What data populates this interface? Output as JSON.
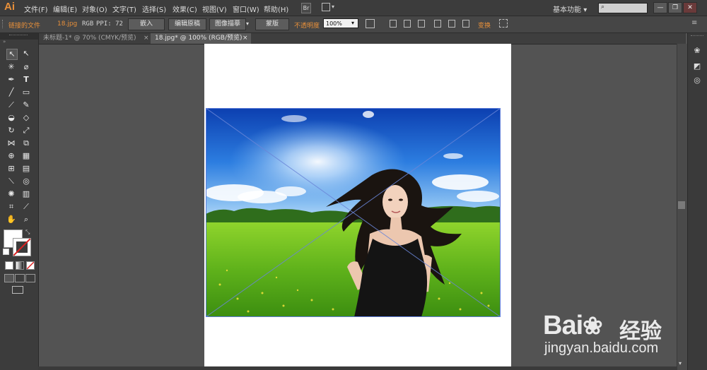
{
  "app": {
    "logo": "Ai"
  },
  "menu": [
    "文件(F)",
    "编辑(E)",
    "对象(O)",
    "文字(T)",
    "选择(S)",
    "效果(C)",
    "视图(V)",
    "窗口(W)",
    "帮助(H)"
  ],
  "bridge_label": "Br",
  "workspace": "基本功能",
  "window_buttons": [
    "—",
    "❐",
    "✕"
  ],
  "control": {
    "linked_file": "链接的文件",
    "file_name": "18.jpg",
    "color_mode": "RGB",
    "ppi": "PPI: 72",
    "embed": "嵌入",
    "edit_original": "编辑原稿",
    "image_trace": "图像描摹",
    "mask": "蒙版",
    "opacity_label": "不透明度",
    "opacity_value": "100%",
    "transform": "变换"
  },
  "tabs": [
    {
      "label": "未标题-1* @ 70% (CMYK/预览)",
      "close": "×",
      "active": false
    },
    {
      "label": "18.jpg* @ 100% (RGB/预览)",
      "close": "×",
      "active": true
    }
  ],
  "watermark": {
    "brand": "Bai",
    "brand_cn": "经验",
    "url": "jingyan.baidu.com"
  },
  "colors": {
    "accent": "#e8903a",
    "ui_dark": "#3c3c3c",
    "canvas_bg": "#535353",
    "selection": "#5a7ad8"
  }
}
